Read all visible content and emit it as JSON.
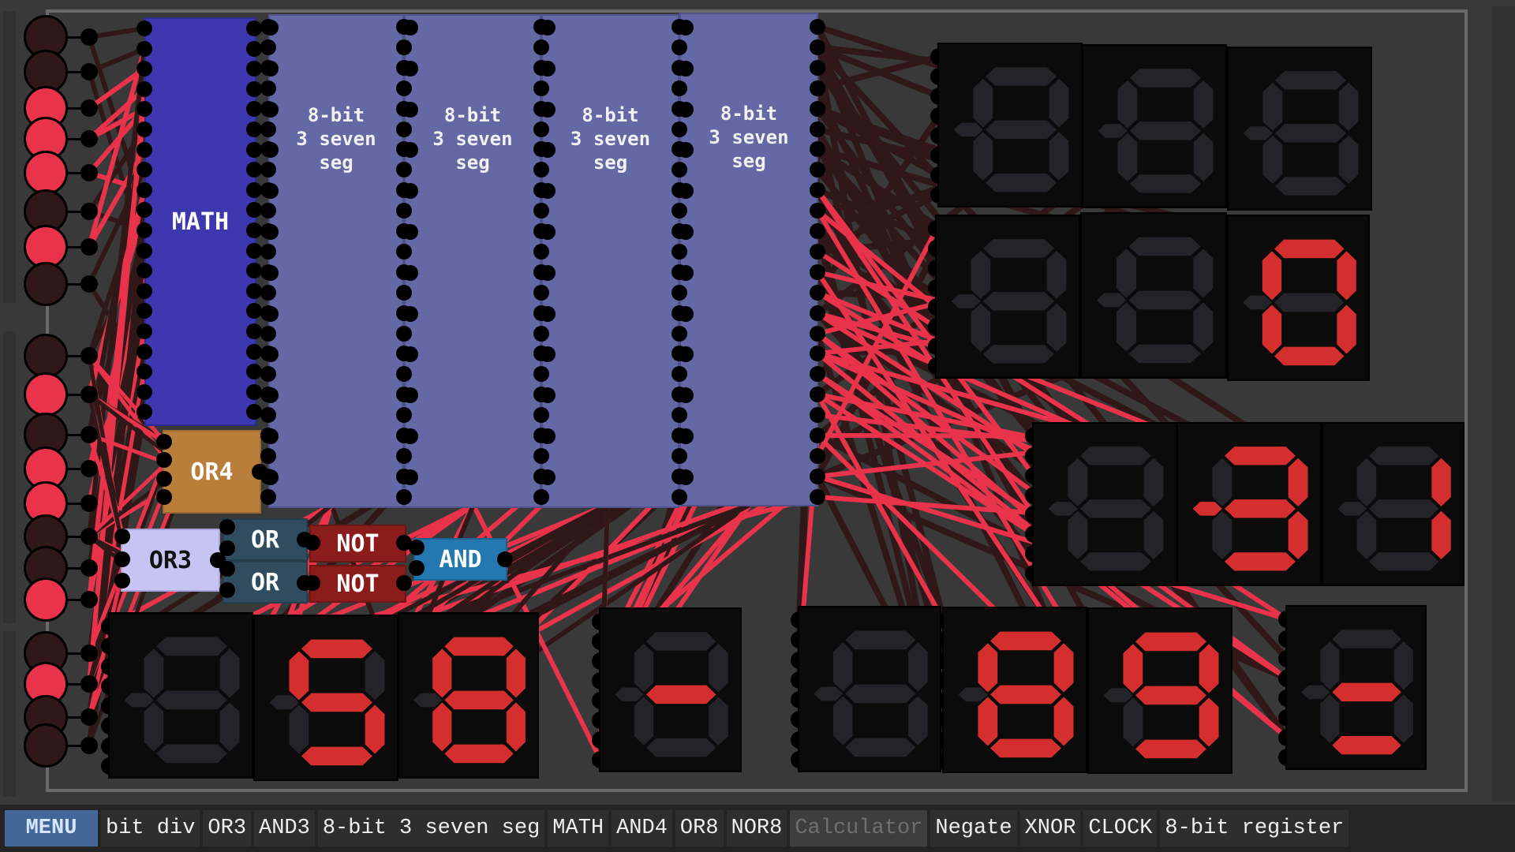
{
  "app": {
    "menu_label": "MENU",
    "toolbar": [
      {
        "label": "bit div",
        "state": "normal"
      },
      {
        "label": "OR3",
        "state": "normal"
      },
      {
        "label": "AND3",
        "state": "normal"
      },
      {
        "label": "8-bit 3 seven seg",
        "state": "normal"
      },
      {
        "label": "MATH",
        "state": "normal"
      },
      {
        "label": "AND4",
        "state": "normal"
      },
      {
        "label": "OR8",
        "state": "normal"
      },
      {
        "label": "NOR8",
        "state": "normal"
      },
      {
        "label": "Calculator",
        "state": "disabled"
      },
      {
        "label": "Negate",
        "state": "normal"
      },
      {
        "label": "XNOR",
        "state": "normal"
      },
      {
        "label": "CLOCK",
        "state": "normal"
      },
      {
        "label": "8-bit register",
        "state": "normal"
      }
    ]
  },
  "colors": {
    "wire_on": "#e8334a",
    "wire_off": "#311818",
    "segment_on": "#d42e2e",
    "segment_off": "#242428"
  },
  "inputs": [
    false,
    false,
    true,
    true,
    true,
    false,
    true,
    false,
    false,
    true,
    false,
    true,
    true,
    false,
    false,
    true,
    false,
    true,
    false,
    false
  ],
  "chips": {
    "math": "MATH",
    "seg_chips": [
      "8-bit\n3 seven\nseg",
      "8-bit\n3 seven\nseg",
      "8-bit\n3 seven\nseg",
      "8-bit\n3 seven\nseg"
    ],
    "or4": "OR4",
    "or3": "OR3",
    "or_top": "OR",
    "or_bottom": "OR",
    "not_top": "NOT",
    "not_bottom": "NOT",
    "and": "AND"
  },
  "displays": [
    {
      "id": "tr1",
      "segments": ""
    },
    {
      "id": "tr2",
      "segments": ""
    },
    {
      "id": "tr3",
      "segments": ""
    },
    {
      "id": "tr4",
      "segments": ""
    },
    {
      "id": "tr5",
      "segments": ""
    },
    {
      "id": "tr6",
      "segments": "abcdef"
    },
    {
      "id": "mr1",
      "segments": ""
    },
    {
      "id": "mr2",
      "segments": "abcdgm"
    },
    {
      "id": "mr3",
      "segments": "bc"
    },
    {
      "id": "bl1",
      "segments": ""
    },
    {
      "id": "bl2",
      "segments": "acdfg"
    },
    {
      "id": "bl3",
      "segments": "abcdefg"
    },
    {
      "id": "bm1",
      "segments": "g"
    },
    {
      "id": "br1",
      "segments": ""
    },
    {
      "id": "br2",
      "segments": "abcdefg"
    },
    {
      "id": "br3",
      "segments": "abcdfg"
    },
    {
      "id": "br4",
      "segments": "dg"
    }
  ]
}
